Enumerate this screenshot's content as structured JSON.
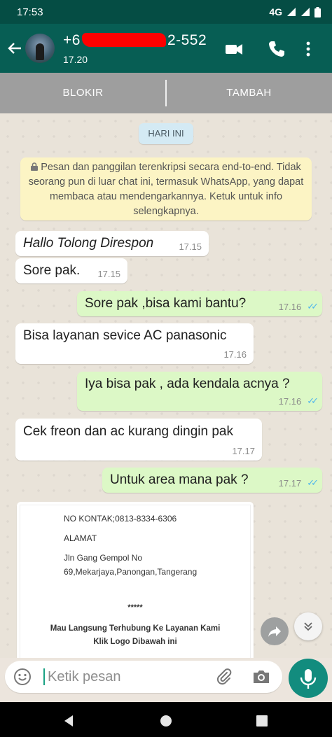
{
  "status_bar": {
    "time": "17:53",
    "network": "4G"
  },
  "header": {
    "contact_prefix": "+6",
    "contact_suffix": "2-552",
    "subtitle": "17.20"
  },
  "action_bar": {
    "block_label": "BLOKIR",
    "add_label": "TAMBAH"
  },
  "chat": {
    "date_chip": "HARI INI",
    "encryption_notice": "Pesan dan panggilan terenkripsi secara end-to-end. Tidak seorang pun di luar chat ini, termasuk WhatsApp, yang dapat membaca atau mendengarkannya. Ketuk untuk info selengkapnya.",
    "messages": [
      {
        "direction": "in",
        "text": "Hallo Tolong Direspon",
        "time": "17.15"
      },
      {
        "direction": "in",
        "text": "Sore pak.",
        "time": "17.15"
      },
      {
        "direction": "out",
        "text": "Sore pak ,bisa kami bantu?",
        "time": "17.16"
      },
      {
        "direction": "in",
        "text": "Bisa layanan sevice AC panasonic",
        "time": "17.16"
      },
      {
        "direction": "out",
        "text": "Iya bisa pak , ada kendala acnya ?",
        "time": "17.16"
      },
      {
        "direction": "in",
        "text": "Cek freon dan ac kurang dingin pak",
        "time": "17.17"
      },
      {
        "direction": "out",
        "text": "Untuk area mana pak ?",
        "time": "17.17"
      }
    ],
    "image_card": {
      "contact_line": "NO KONTAK;0813-8334-6306",
      "address_label": "ALAMAT",
      "address_line1": "Jln Gang Gempol No",
      "address_line2": "69,Mekarjaya,Panongan,Tangerang",
      "stars": "*****",
      "cta_line1": "Mau Langsung Terhubung Ke Layanan Kami",
      "cta_line2": "Klik Logo Dibawah ini"
    }
  },
  "composer": {
    "placeholder": "Ketik pesan"
  },
  "colors": {
    "header": "#075e54",
    "outgoing": "#dcf8c6",
    "incoming": "#ffffff",
    "accent": "#128c7e",
    "read_ticks": "#4fb6ec"
  },
  "icons": [
    "back-arrow-icon",
    "video-call-icon",
    "phone-icon",
    "more-vert-icon",
    "lock-icon",
    "forward-icon",
    "chevron-down-icon",
    "emoji-icon",
    "attach-icon",
    "camera-icon",
    "mic-icon",
    "nav-back-icon",
    "nav-home-icon",
    "nav-recents-icon"
  ]
}
